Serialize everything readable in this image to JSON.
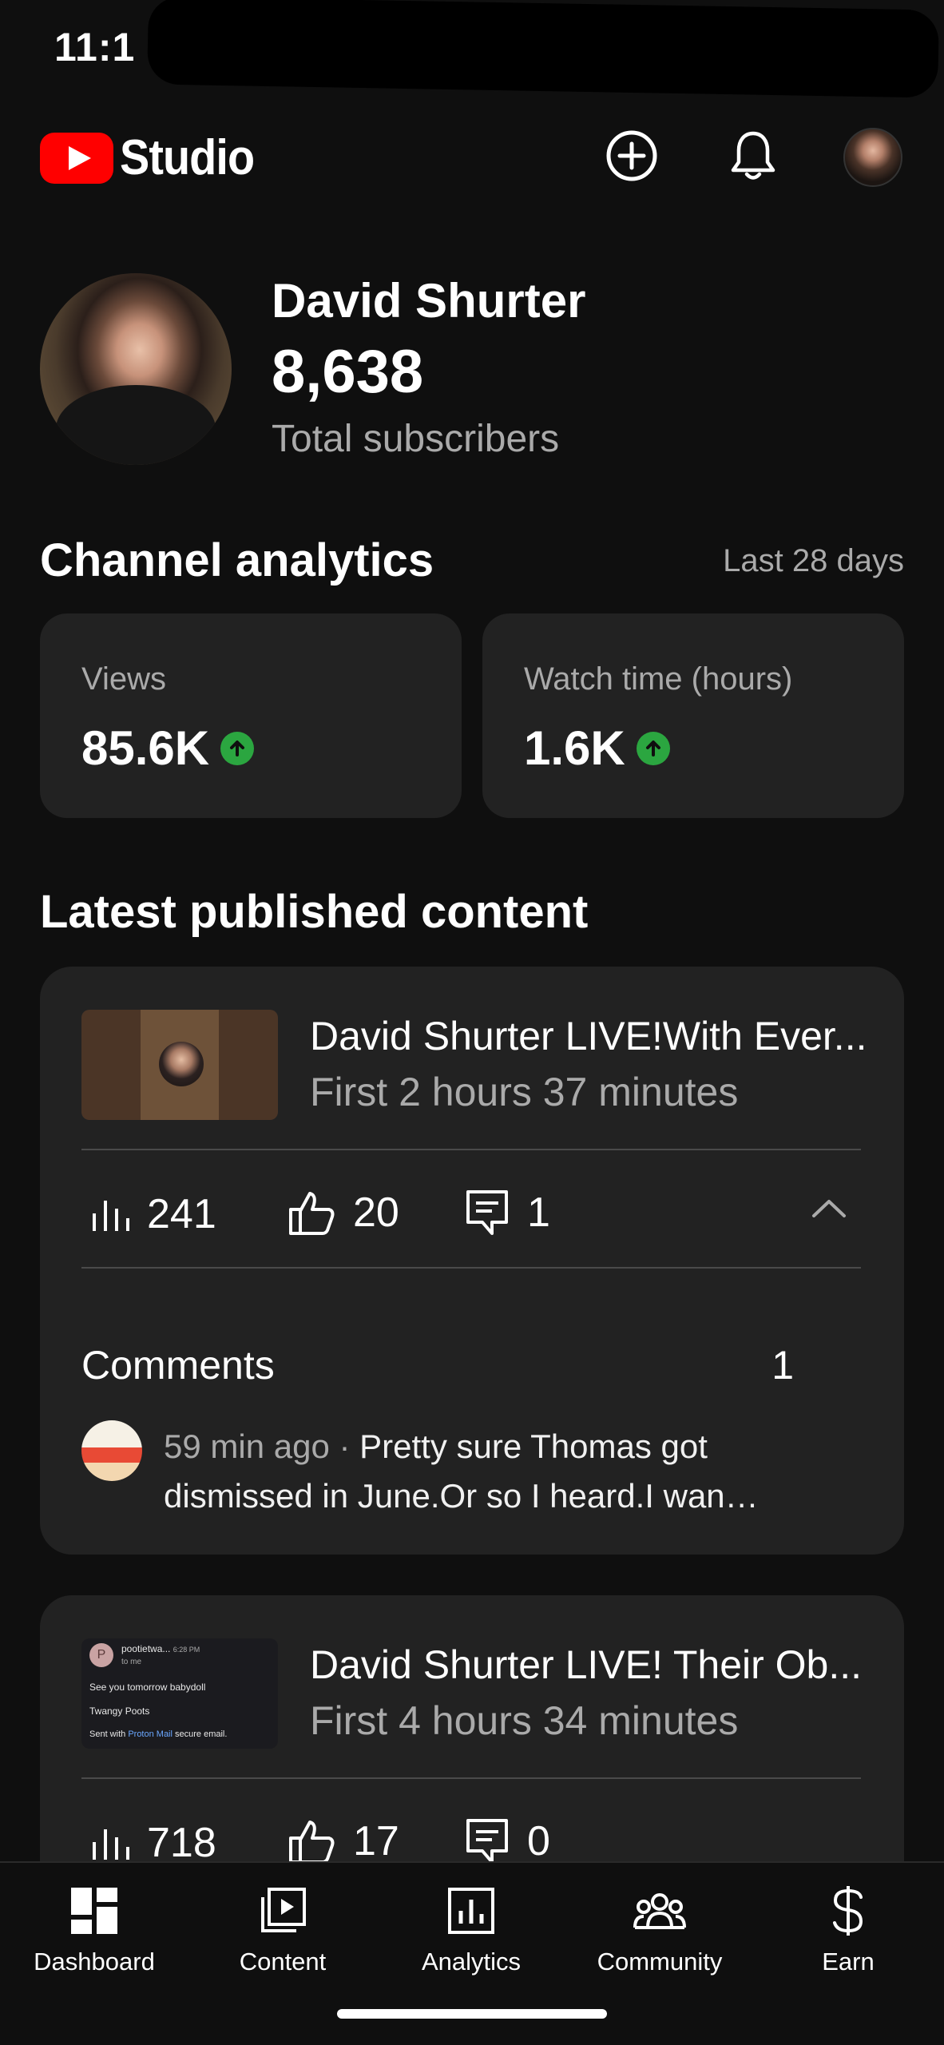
{
  "status_bar": {
    "time": "11:1"
  },
  "header": {
    "logo_text": "Studio",
    "icons": [
      "create-icon",
      "notifications-bell-icon",
      "account-avatar"
    ],
    "brand_color": "#ff0000"
  },
  "profile": {
    "name": "David Shurter",
    "subscribers": "8,638",
    "subscribers_label": "Total subscribers"
  },
  "analytics": {
    "title": "Channel analytics",
    "range": "Last 28 days",
    "metrics": [
      {
        "label": "Views",
        "value": "85.6K",
        "trend": "up"
      },
      {
        "label": "Watch time (hours)",
        "value": "1.6K",
        "trend": "up"
      }
    ],
    "trend_color": "#2ba640"
  },
  "latest": {
    "title": "Latest published content",
    "items": [
      {
        "title": "David Shurter LIVE!With Ever...",
        "subtitle": "First 2 hours 37 minutes",
        "views": "241",
        "likes": "20",
        "comments": "1",
        "comments_section": {
          "heading": "Comments",
          "count": "1",
          "comment_meta": "59 min ago · ",
          "comment_line1": "Pretty sure Thomas got",
          "comment_line2": "dismissed in June.Or so I heard.I wanna he..."
        }
      },
      {
        "title": "David Shurter LIVE! Their Ob...",
        "subtitle": "First 4 hours 34 minutes",
        "views": "718",
        "likes": "17",
        "comments": "0",
        "thumbnail_text": {
          "sender": "pootietwa...",
          "time": "6:28 PM",
          "to": "to me",
          "avatar_letter": "P",
          "line1": "See you tomorrow babydoll",
          "line2": "Twangy Poots",
          "line3_prefix": "Sent with ",
          "line3_link": "Proton Mail",
          "line3_suffix": " secure email."
        }
      }
    ]
  },
  "bottom_nav": {
    "items": [
      {
        "label": "Dashboard",
        "icon": "dashboard-icon"
      },
      {
        "label": "Content",
        "icon": "content-icon"
      },
      {
        "label": "Analytics",
        "icon": "analytics-icon"
      },
      {
        "label": "Community",
        "icon": "community-icon"
      },
      {
        "label": "Earn",
        "icon": "earn-icon"
      }
    ]
  }
}
